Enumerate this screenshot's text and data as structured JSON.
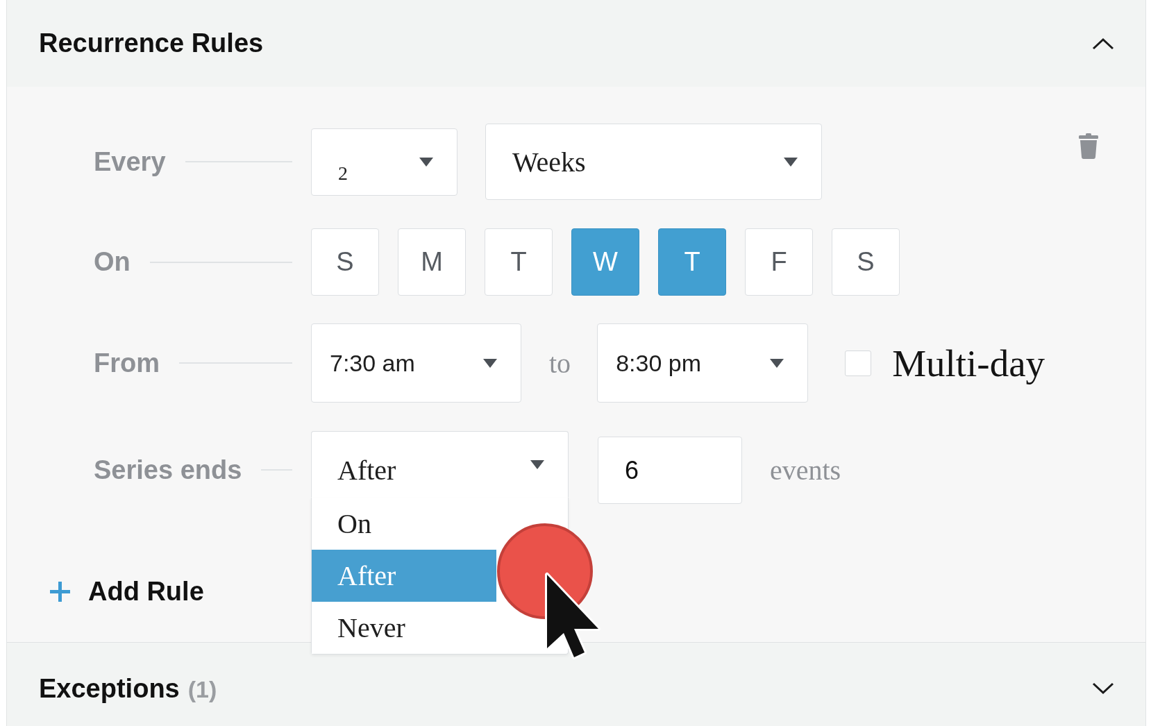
{
  "recurrence_rules": {
    "title": "Recurrence Rules",
    "expanded": true,
    "rules": [
      {
        "every": {
          "label": "Every",
          "interval": {
            "value": "2"
          },
          "unit": {
            "value": "Weeks"
          }
        },
        "on": {
          "label": "On",
          "days": [
            {
              "label": "S",
              "selected": false
            },
            {
              "label": "M",
              "selected": false
            },
            {
              "label": "T",
              "selected": false
            },
            {
              "label": "W",
              "selected": true
            },
            {
              "label": "T",
              "selected": true
            },
            {
              "label": "F",
              "selected": false
            },
            {
              "label": "S",
              "selected": false
            }
          ]
        },
        "from": {
          "label": "From",
          "start": {
            "value": "7:30 am"
          },
          "separator": "to",
          "end": {
            "value": "8:30 pm"
          },
          "multi_day": {
            "label": "Multi-day",
            "checked": false
          }
        },
        "series_ends": {
          "label": "Series ends",
          "end_type": {
            "value": "After",
            "expanded": true,
            "options": [
              {
                "label": "On",
                "selected": false
              },
              {
                "label": "After",
                "selected": true
              },
              {
                "label": "Never",
                "selected": false
              }
            ]
          },
          "count": {
            "value": "6"
          },
          "count_unit": "events"
        }
      }
    ],
    "add_rule": {
      "label": "Add Rule"
    }
  },
  "exceptions": {
    "title": "Exceptions",
    "count": "(1)",
    "expanded": false
  }
}
